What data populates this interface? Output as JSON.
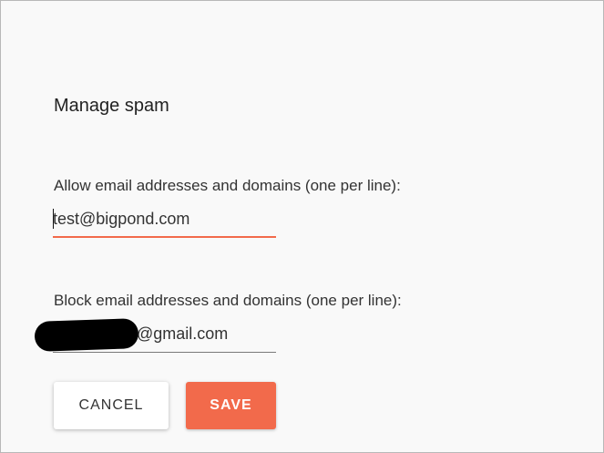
{
  "dialog": {
    "title": "Manage spam"
  },
  "allow": {
    "label": "Allow email addresses and domains (one per line):",
    "value": "test@bigpond.com"
  },
  "block": {
    "label": "Block email addresses and domains (one per line):",
    "value": "@gmail.com"
  },
  "buttons": {
    "cancel": "CANCEL",
    "save": "SAVE"
  },
  "colors": {
    "accent": "#f26a4b",
    "background": "#fafafa"
  }
}
